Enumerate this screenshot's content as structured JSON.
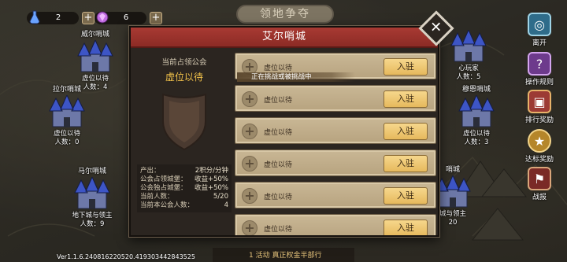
{
  "resources": [
    {
      "value": "2",
      "icon": "potion-icon",
      "color": "#6aa3ff"
    },
    {
      "value": "6",
      "icon": "gem-icon",
      "color": "#c06be0"
    }
  ],
  "map_title": "领地争夺",
  "castles": [
    {
      "name": "威尔哨城",
      "owner": "虚位以待",
      "members": "人数：4"
    },
    {
      "name": "拉尔哨城",
      "owner": "虚位以待",
      "members": "人数：0"
    },
    {
      "name": "马尔哨城",
      "owner": "地下城与领主",
      "members": "人数：9"
    },
    {
      "name": "",
      "owner": "心玩家",
      "members": "人数：5"
    },
    {
      "name": "穆恩哨城",
      "owner": "虚位以待",
      "members": "人数：3"
    },
    {
      "name": "哨城",
      "owner": "城与领主",
      "members": "20"
    }
  ],
  "side_menu": [
    {
      "label": "离开",
      "icon": "swirl-portal-icon"
    },
    {
      "label": "操作规则",
      "icon": "question-book-icon"
    },
    {
      "label": "排行奖励",
      "icon": "treasure-chest-icon"
    },
    {
      "label": "达标奖励",
      "icon": "star-badge-icon"
    },
    {
      "label": "战报",
      "icon": "flag-icon"
    }
  ],
  "version": "Ver1.1.6.240816220520.419303442843525",
  "bottom_strip": "1 活动     真正权金半部行",
  "dialog": {
    "title": "艾尔哨城",
    "current_label": "当前占领公会",
    "current_guild": "虚位以待",
    "stats": [
      {
        "k": "产出：",
        "v": "2积分/分钟"
      },
      {
        "k": "公会占领城堡：",
        "v": "收益+50%"
      },
      {
        "k": "公会独占城堡：",
        "v": "收益+50%"
      },
      {
        "k": "当前人数：",
        "v": "5/20"
      },
      {
        "k": "当前本公会人数：",
        "v": "4"
      }
    ],
    "challenge_banner": "正在挑战或被挑战中",
    "join_label": "入驻",
    "slots": [
      {
        "name": "虚位以待"
      },
      {
        "name": "虚位以待"
      },
      {
        "name": "虚位以待"
      },
      {
        "name": "虚位以待"
      },
      {
        "name": "虚位以待"
      },
      {
        "name": "虚位以待"
      }
    ]
  }
}
